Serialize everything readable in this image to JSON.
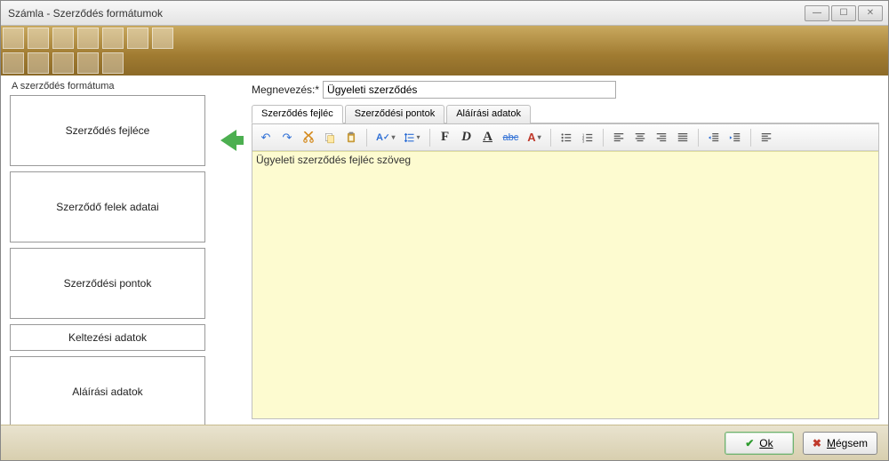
{
  "window": {
    "title": "Számla - Szerződés formátumok"
  },
  "left": {
    "group_label": "A szerződés formátuma",
    "items": [
      {
        "label": "Szerződés fejléce",
        "size": "large"
      },
      {
        "label": "Szerződő felek adatai",
        "size": "large"
      },
      {
        "label": "Szerződési pontok",
        "size": "large"
      },
      {
        "label": "Keltezési adatok",
        "size": "small"
      },
      {
        "label": "Aláírási adatok",
        "size": "large"
      }
    ]
  },
  "name_field": {
    "label": "Megnevezés:*",
    "value": "Ügyeleti szerződés"
  },
  "tabs": [
    {
      "label": "Szerződés fejléc",
      "active": true
    },
    {
      "label": "Szerződési pontok",
      "active": false
    },
    {
      "label": "Aláírási adatok",
      "active": false
    }
  ],
  "editor": {
    "text": "Ügyeleti szerződés fejléc szöveg"
  },
  "buttons": {
    "ok": "Ok",
    "cancel": "Mégsem"
  }
}
